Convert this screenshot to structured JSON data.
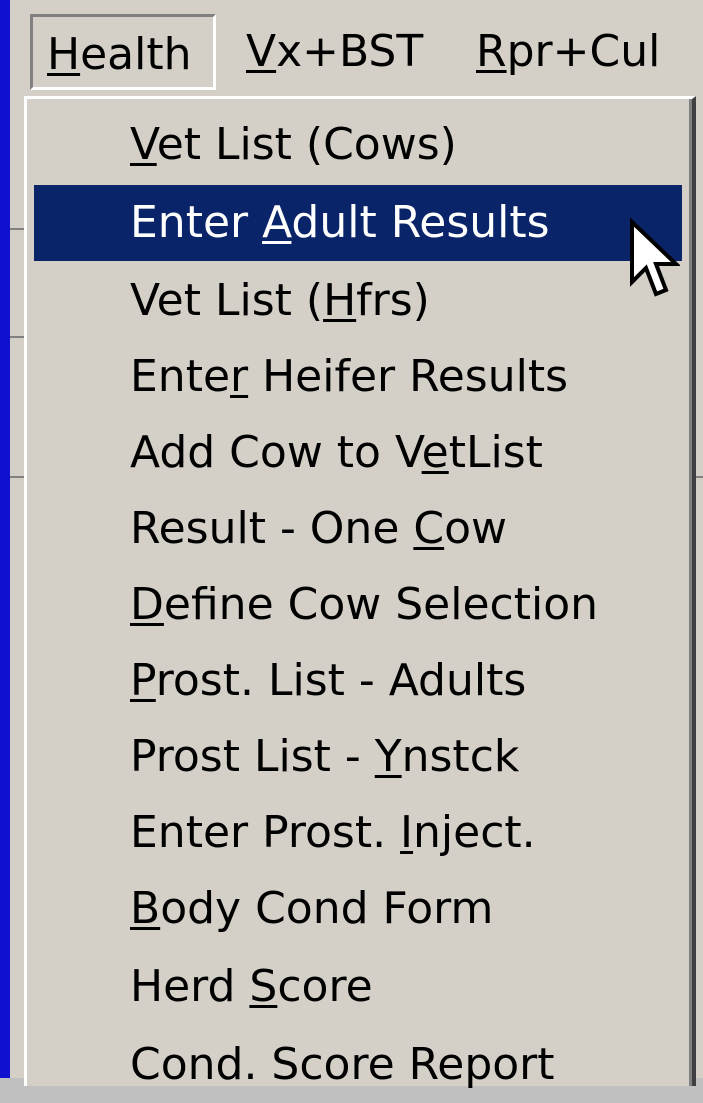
{
  "menubar": {
    "items": [
      {
        "pre": "",
        "key": "H",
        "post": "ealth",
        "active": true
      },
      {
        "pre": "",
        "key": "V",
        "post": "x+BST",
        "active": false
      },
      {
        "pre": "",
        "key": "R",
        "post": "pr+Cul",
        "active": false
      }
    ]
  },
  "health_menu": {
    "items": [
      {
        "pre": "",
        "key": "V",
        "post": "et List (Cows)",
        "highlighted": false
      },
      {
        "pre": "Enter ",
        "key": "A",
        "post": "dult Results",
        "highlighted": true
      },
      {
        "pre": "Vet List (",
        "key": "H",
        "post": "frs)",
        "highlighted": false
      },
      {
        "pre": "Ente",
        "key": "r",
        "post": " Heifer Results",
        "highlighted": false
      },
      {
        "pre": "Add Cow to V",
        "key": "e",
        "post": "tList",
        "highlighted": false
      },
      {
        "pre": "Result - One ",
        "key": "C",
        "post": "ow",
        "highlighted": false
      },
      {
        "pre": "",
        "key": "D",
        "post": "efine Cow Selection",
        "highlighted": false
      },
      {
        "pre": "",
        "key": "P",
        "post": "rost. List - Adults",
        "highlighted": false
      },
      {
        "pre": "Prost List - ",
        "key": "Y",
        "post": "nstck",
        "highlighted": false
      },
      {
        "pre": "Enter Prost. ",
        "key": "I",
        "post": "nject.",
        "highlighted": false
      },
      {
        "pre": "",
        "key": "B",
        "post": "ody Cond Form",
        "highlighted": false
      },
      {
        "pre": "Herd ",
        "key": "S",
        "post": "core",
        "highlighted": false
      },
      {
        "pre": "",
        "key": "",
        "post": "Cond. Score Report",
        "highlighted": false
      }
    ]
  },
  "colors": {
    "menu_bg": "#d4d0c8",
    "highlight_bg": "#0a246a",
    "highlight_fg": "#ffffff",
    "desktop_strip": "#1010d0"
  },
  "icons": {
    "cursor": "arrow-cursor-icon"
  }
}
